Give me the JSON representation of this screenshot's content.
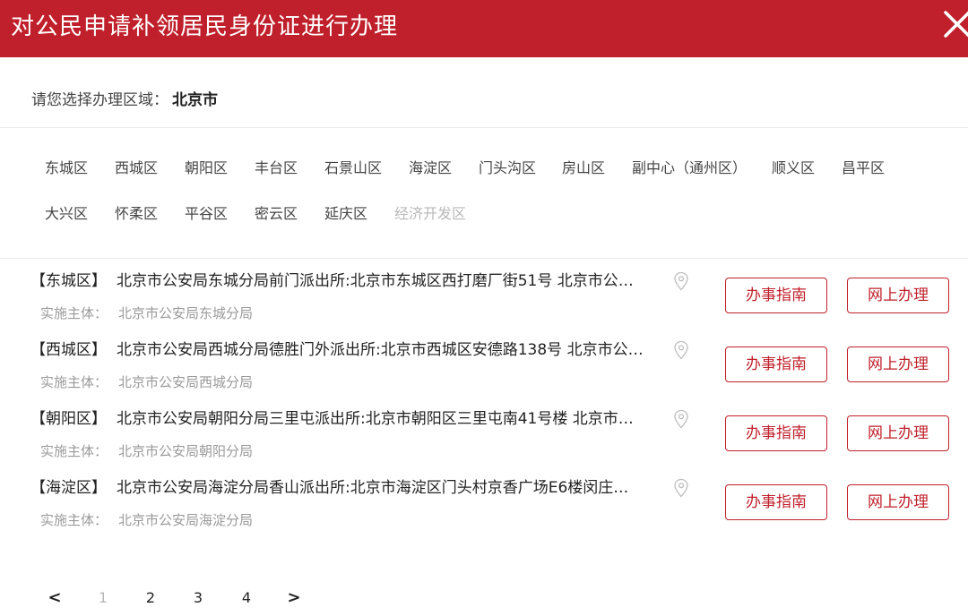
{
  "header": {
    "title": "对公民申请补领居民身份证进行办理",
    "close_icon": "close-icon",
    "bg_color": "#c0202b"
  },
  "region": {
    "label": "请您选择办理区域：",
    "value": "北京市"
  },
  "districts": [
    {
      "label": "东城区",
      "enabled": true
    },
    {
      "label": "西城区",
      "enabled": true
    },
    {
      "label": "朝阳区",
      "enabled": true
    },
    {
      "label": "丰台区",
      "enabled": true
    },
    {
      "label": "石景山区",
      "enabled": true
    },
    {
      "label": "海淀区",
      "enabled": true
    },
    {
      "label": "门头沟区",
      "enabled": true
    },
    {
      "label": "房山区",
      "enabled": true
    },
    {
      "label": "副中心（通州区）",
      "enabled": true
    },
    {
      "label": "顺义区",
      "enabled": true
    },
    {
      "label": "昌平区",
      "enabled": true
    },
    {
      "label": "大兴区",
      "enabled": true
    },
    {
      "label": "怀柔区",
      "enabled": true
    },
    {
      "label": "平谷区",
      "enabled": true
    },
    {
      "label": "密云区",
      "enabled": true
    },
    {
      "label": "延庆区",
      "enabled": true
    },
    {
      "label": "经济开发区",
      "enabled": false
    }
  ],
  "list": {
    "subject_label": "实施主体：",
    "guide_label": "办事指南",
    "online_label": "网上办理",
    "location_icon": "location-pin-icon",
    "items": [
      {
        "tag": "【东城区】",
        "text": "北京市公安局东城分局前门派出所:北京市东城区西打磨厂街51号 北京市公…",
        "subject": "北京市公安局东城分局"
      },
      {
        "tag": "【西城区】",
        "text": "北京市公安局西城分局德胜门外派出所:北京市西城区安德路138号 北京市公…",
        "subject": "北京市公安局西城分局"
      },
      {
        "tag": "【朝阳区】",
        "text": "北京市公安局朝阳分局三里屯派出所:北京市朝阳区三里屯南41号楼 北京市…",
        "subject": "北京市公安局朝阳分局"
      },
      {
        "tag": "【海淀区】",
        "text": "北京市公安局海淀分局香山派出所:北京市海淀区门头村京香广场E6楼闵庄…",
        "subject": "北京市公安局海淀分局"
      }
    ]
  },
  "pagination": {
    "prev": "<",
    "pages": [
      "1",
      "2",
      "3",
      "4"
    ],
    "current": "1",
    "next": ">"
  },
  "colors": {
    "accent": "#c0202b",
    "muted": "#9a9a9a",
    "disabled": "#b8b8b8"
  }
}
